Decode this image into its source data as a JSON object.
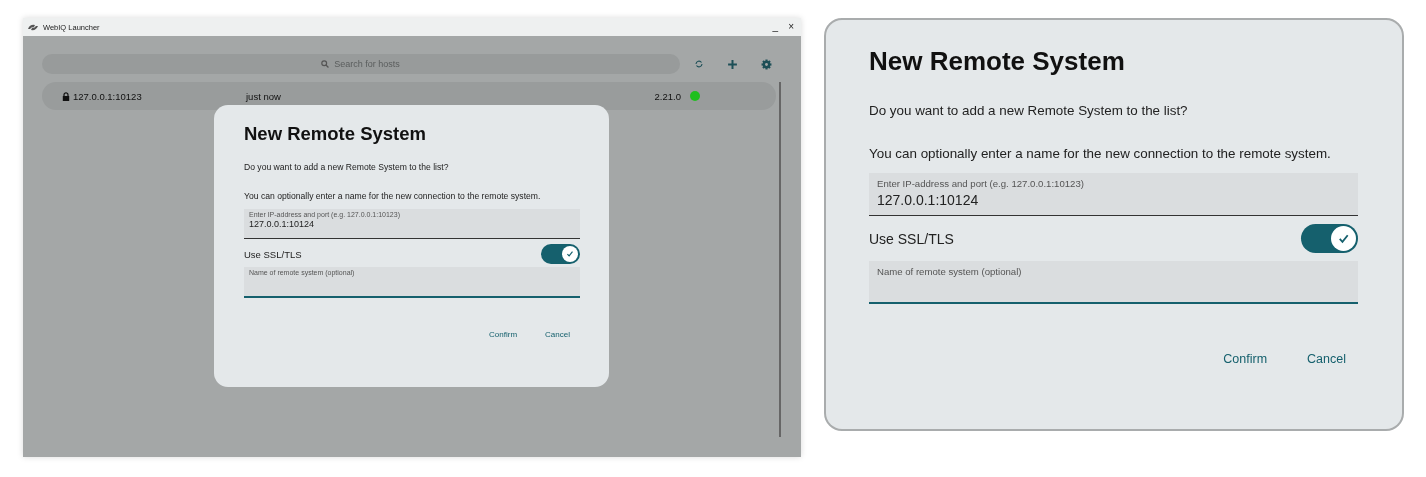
{
  "window": {
    "title": "WebIQ Launcher",
    "minimize": "_",
    "close": "×"
  },
  "search": {
    "placeholder": "Search for hosts"
  },
  "hosts": [
    {
      "address": "127.0.0.1:10123",
      "locked": true,
      "time": "just now",
      "version": "2.21.0",
      "color": "#1fbf1f"
    }
  ],
  "dialog": {
    "title": "New Remote System",
    "question": "Do you want to add a new Remote System to the list?",
    "hint": "You can optionally enter a name for the new connection to the remote system.",
    "ip_field": {
      "label": "Enter IP-address and port (e.g. 127.0.0.1:10123)",
      "value": "127.0.0.1:10124"
    },
    "ssl": {
      "label": "Use SSL/TLS",
      "on": true
    },
    "name_field": {
      "label": "Name of remote system (optional)",
      "focused": true
    },
    "buttons": [
      "Confirm",
      "Cancel"
    ]
  },
  "enlarged_dialog": {
    "title": "New Remote System",
    "question": "Do you want to add a new Remote System to the list?",
    "hint": "You can optionally enter a name for the new connection to the remote system.",
    "ip_field": {
      "label": "Enter IP-address and port (e.g. 127.0.0.1:10123)",
      "value": "127.0.0.1:10124"
    },
    "ssl": {
      "label": "Use SSL/TLS",
      "on": true
    },
    "name_field": {
      "label": "Name of remote system (optional)",
      "focused": true
    },
    "buttons": [
      "Confirm",
      "Cancel"
    ]
  }
}
